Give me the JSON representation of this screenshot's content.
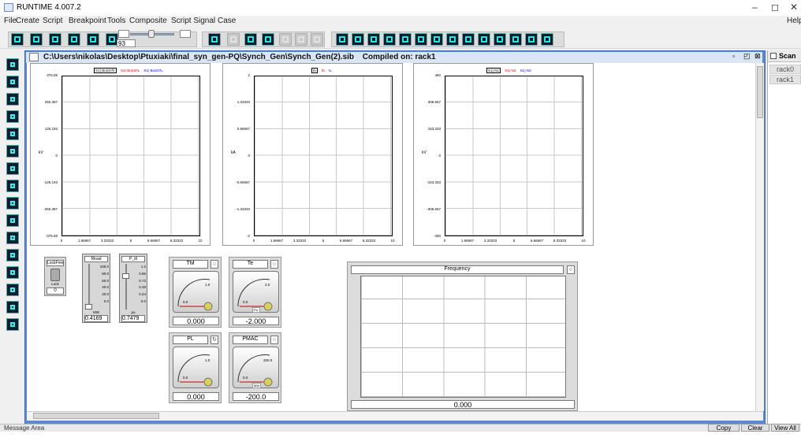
{
  "window": {
    "title": "RUNTIME 4.007.2",
    "minimize": "–",
    "restore": "◻",
    "close": "✕"
  },
  "menu": [
    "File",
    "Create",
    "Script",
    "Breakpoint",
    "Tools",
    "Composite",
    "Script Signal",
    "Case"
  ],
  "menu_help": "Help",
  "toolbar": {
    "slider_value": "93"
  },
  "document": {
    "path": "C:\\Users\\nikolas\\Desktop\\Ptuxiaki\\final_syn_gen-PQ\\Synch_Gen\\Synch_Gen(2).sib",
    "compiled": "Compiled on: rack1",
    "title_btns": [
      "▫",
      "◰",
      "⊠"
    ]
  },
  "right_panel": {
    "title": "Scan",
    "racks": [
      "rack0",
      "rack1"
    ]
  },
  "plots": [
    {
      "legend_box": "S1) BuSS7lr",
      "legend": [
        {
          "text": "S1) BuS37L",
          "color": "red"
        },
        {
          "text": "S1) BuS37L",
          "color": "blue"
        }
      ],
      "ylabel": "kV",
      "yticks": [
        "375.59",
        "250.387",
        "125.193",
        "0",
        "-125.193",
        "-250.387",
        "-375.58"
      ],
      "xticks": [
        "0",
        "1.66667",
        "3.33333",
        "5",
        "6.66667",
        "8.33333",
        "10"
      ]
    },
    {
      "legend_box": "Ib",
      "legend": [
        {
          "text": "Ib",
          "color": "red"
        },
        {
          "text": "IL",
          "color": "blue"
        }
      ],
      "ylabel": "kA",
      "yticks": [
        "2",
        "1.33333",
        "0.66667",
        "0",
        "-0.66667",
        "-1.33333",
        "-2"
      ],
      "xticks": [
        "0",
        "1.66667",
        "3.33333",
        "5",
        "6.66667",
        "8.33333",
        "10"
      ]
    },
    {
      "legend_box": "S1) N1",
      "legend": [
        {
          "text": "S1) N2",
          "color": "red"
        },
        {
          "text": "S1) N3",
          "color": "blue"
        }
      ],
      "ylabel": "kV",
      "yticks": [
        "460",
        "306.667",
        "153.333",
        "0",
        "-153.333",
        "-306.667",
        "-460"
      ],
      "xticks": [
        "0",
        "1.66667",
        "3.33333",
        "5",
        "6.66667",
        "8.33333",
        "10"
      ]
    }
  ],
  "controls": {
    "lock": {
      "title": "LockFree",
      "label": "Lock",
      "value": "0"
    },
    "sliders": [
      {
        "title": "Rload",
        "ticks": [
          "100.0",
          "80.0",
          "60.0",
          "40.0",
          "20.0",
          "0.0"
        ],
        "unit": "MW",
        "value": "0.4169"
      },
      {
        "title": "P_ttl",
        "ticks": [
          "1.2",
          "0.96",
          "0.72",
          "0.48",
          "0.24",
          "0.0"
        ],
        "unit": "pu",
        "value": "0.7479"
      }
    ]
  },
  "meters": [
    {
      "title": "TM",
      "btn": "○",
      "scale": [
        "0.0",
        "1.0"
      ],
      "value": "0.000"
    },
    {
      "title": "Te",
      "btn": "○",
      "scale": [
        "0.0",
        "2.0"
      ],
      "unit": "PU",
      "value": "-2.000"
    },
    {
      "title": "PL",
      "btn": "↻",
      "scale": [
        "0.0",
        "1.0"
      ],
      "value": "0.000"
    },
    {
      "title": "PMAC",
      "btn": "○",
      "scale": [
        "0.0",
        "200.0"
      ],
      "unit": "MW",
      "value": "-200.0"
    }
  ],
  "frequency": {
    "title": "Frequency",
    "btn": "○",
    "value": "0.000"
  },
  "message": {
    "label": "Message Area",
    "buttons": [
      "Copy",
      "Clear",
      "View All"
    ]
  },
  "colors": {
    "mdi_border": "#5b8ad1",
    "tool_bg": "#0b1e30",
    "tool_glyph": "#2ee6e0",
    "legend_red": "#dd0000",
    "legend_blue": "#0000cc"
  }
}
